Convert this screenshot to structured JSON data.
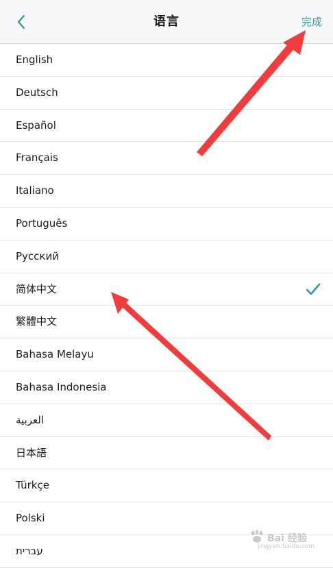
{
  "header": {
    "title": "语言",
    "done_label": "完成"
  },
  "languages": [
    {
      "label": "English",
      "selected": false
    },
    {
      "label": "Deutsch",
      "selected": false
    },
    {
      "label": "Español",
      "selected": false
    },
    {
      "label": "Français",
      "selected": false
    },
    {
      "label": "Italiano",
      "selected": false
    },
    {
      "label": "Português",
      "selected": false
    },
    {
      "label": "Русский",
      "selected": false
    },
    {
      "label": "简体中文",
      "selected": true
    },
    {
      "label": "繁體中文",
      "selected": false
    },
    {
      "label": "Bahasa Melayu",
      "selected": false
    },
    {
      "label": "Bahasa Indonesia",
      "selected": false
    },
    {
      "label": "العربية",
      "selected": false
    },
    {
      "label": "日本語",
      "selected": false
    },
    {
      "label": "Türkçe",
      "selected": false
    },
    {
      "label": "Polski",
      "selected": false
    },
    {
      "label": "עברית",
      "selected": false
    }
  ],
  "colors": {
    "accent": "#2f9ca0",
    "annotation_arrow": "#f03c3c"
  },
  "icons": {
    "back": "chevron-left-icon",
    "selected": "checkmark-icon"
  },
  "watermark": {
    "text": "Bai 经验",
    "sub": "jingyan.baidu.com"
  }
}
